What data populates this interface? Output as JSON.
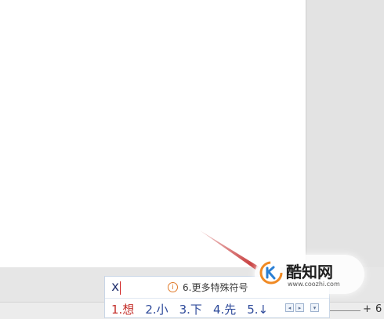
{
  "ime": {
    "composition": "x",
    "hint_icon": "info-icon",
    "hint_text": "6.更多特殊符号",
    "candidates": [
      "1.想",
      "2.小",
      "3.下",
      "4.先",
      "5.↓"
    ],
    "nav": {
      "prev": "◂",
      "next": "▸",
      "menu": "▾"
    }
  },
  "status": {
    "zoom_plus": "+",
    "zoom_value": "6"
  },
  "watermark": {
    "title": "酷知网",
    "url": "www.coozhi.com"
  },
  "colors": {
    "accent_red": "#c4302b",
    "candidate_blue": "#2e4a9a",
    "hint_orange": "#e07a2a"
  }
}
